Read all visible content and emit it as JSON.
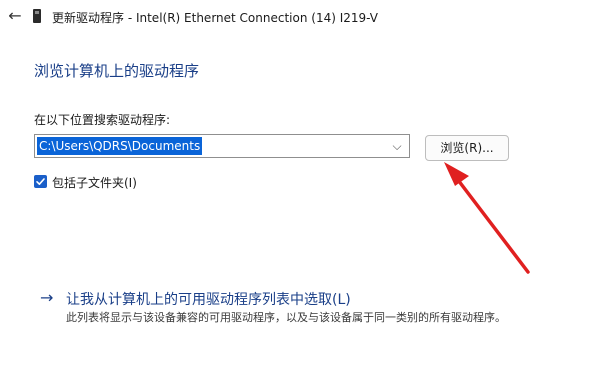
{
  "window": {
    "back_icon": "back-arrow-icon",
    "device_icon": "device-icon",
    "title": "更新驱动程序 - Intel(R) Ethernet Connection (14) I219-V"
  },
  "main": {
    "heading": "浏览计算机上的驱动程序",
    "search_label": "在以下位置搜索驱动程序:",
    "path_value": "C:\\Users\\QDRS\\Documents",
    "browse_label": "浏览(R)...",
    "include_subfolders_label": "包括子文件夹(I)",
    "include_subfolders_checked": true,
    "pick_link_label": "让我从计算机上的可用驱动程序列表中选取(L)",
    "pick_description": "此列表将显示与该设备兼容的可用驱动程序，以及与该设备属于同一类别的所有驱动程序。"
  },
  "colors": {
    "accent": "#1a3f88",
    "selection": "#0a64d8",
    "checkbox": "#1a5fc9",
    "annotation_arrow": "#e02020"
  }
}
